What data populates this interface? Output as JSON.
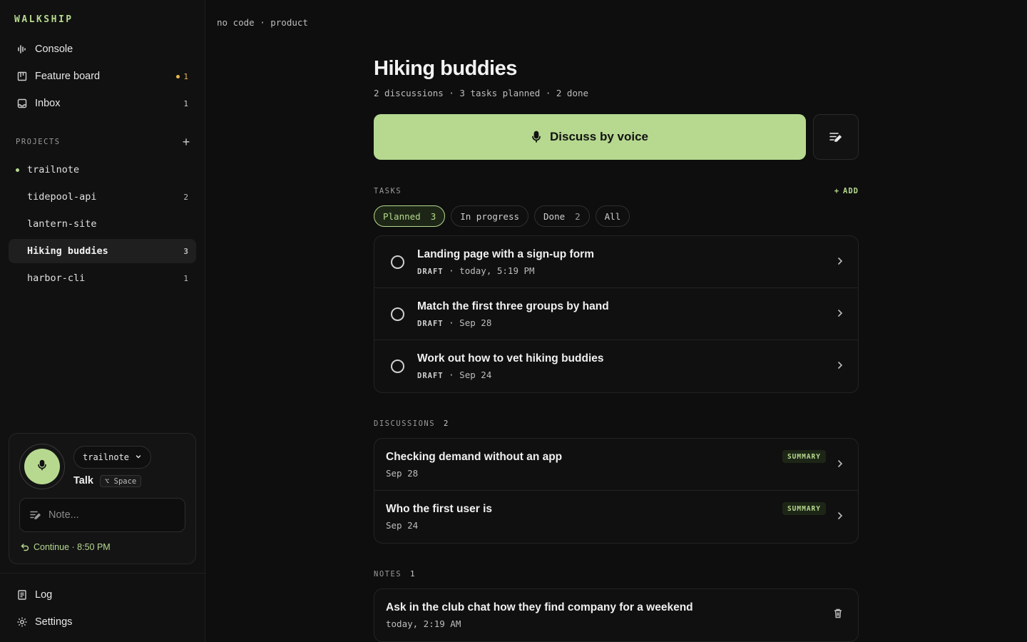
{
  "brand": "WALKSHIP",
  "nav": {
    "console": "Console",
    "feature_board": "Feature board",
    "feature_board_count": "1",
    "inbox": "Inbox",
    "inbox_count": "1"
  },
  "projects": {
    "label": "PROJECTS",
    "add": "+",
    "items": [
      {
        "name": "trailnote",
        "count": ""
      },
      {
        "name": "tidepool-api",
        "count": "2"
      },
      {
        "name": "lantern-site",
        "count": ""
      },
      {
        "name": "Hiking buddies",
        "count": "3"
      },
      {
        "name": "harbor-cli",
        "count": "1"
      }
    ]
  },
  "talk": {
    "project": "trailnote",
    "label": "Talk",
    "shortcut": "⌥ Space",
    "note_placeholder": "Note...",
    "continue": "Continue · 8:50 PM"
  },
  "bottom_nav": {
    "log": "Log",
    "settings": "Settings"
  },
  "breadcrumb": "no code · product",
  "page": {
    "title": "Hiking buddies",
    "subtitle": "2 discussions · 3 tasks planned · 2 done",
    "voice_button": "Discuss by voice"
  },
  "tasks": {
    "label": "TASKS",
    "add": "ADD",
    "filters": [
      {
        "label": "Planned",
        "count": "3"
      },
      {
        "label": "In progress",
        "count": ""
      },
      {
        "label": "Done",
        "count": "2"
      },
      {
        "label": "All",
        "count": ""
      }
    ],
    "items": [
      {
        "title": "Landing page with a sign-up form",
        "status": "DRAFT",
        "date": " · today, 5:19 PM"
      },
      {
        "title": "Match the first three groups by hand",
        "status": "DRAFT",
        "date": " · Sep 28"
      },
      {
        "title": "Work out how to vet hiking buddies",
        "status": "DRAFT",
        "date": " · Sep 24"
      }
    ]
  },
  "discussions": {
    "label": "DISCUSSIONS",
    "count": "2",
    "items": [
      {
        "title": "Checking demand without an app",
        "date": "Sep 28",
        "badge": "SUMMARY"
      },
      {
        "title": "Who the first user is",
        "date": "Sep 24",
        "badge": "SUMMARY"
      }
    ]
  },
  "notes": {
    "label": "NOTES",
    "count": "1",
    "items": [
      {
        "title": "Ask in the club chat how they find company for a weekend",
        "date": "today, 2:19 AM"
      }
    ]
  },
  "colors": {
    "accent": "#b6d98f",
    "warning": "#e8b64f",
    "background": "#0e0e0e"
  }
}
